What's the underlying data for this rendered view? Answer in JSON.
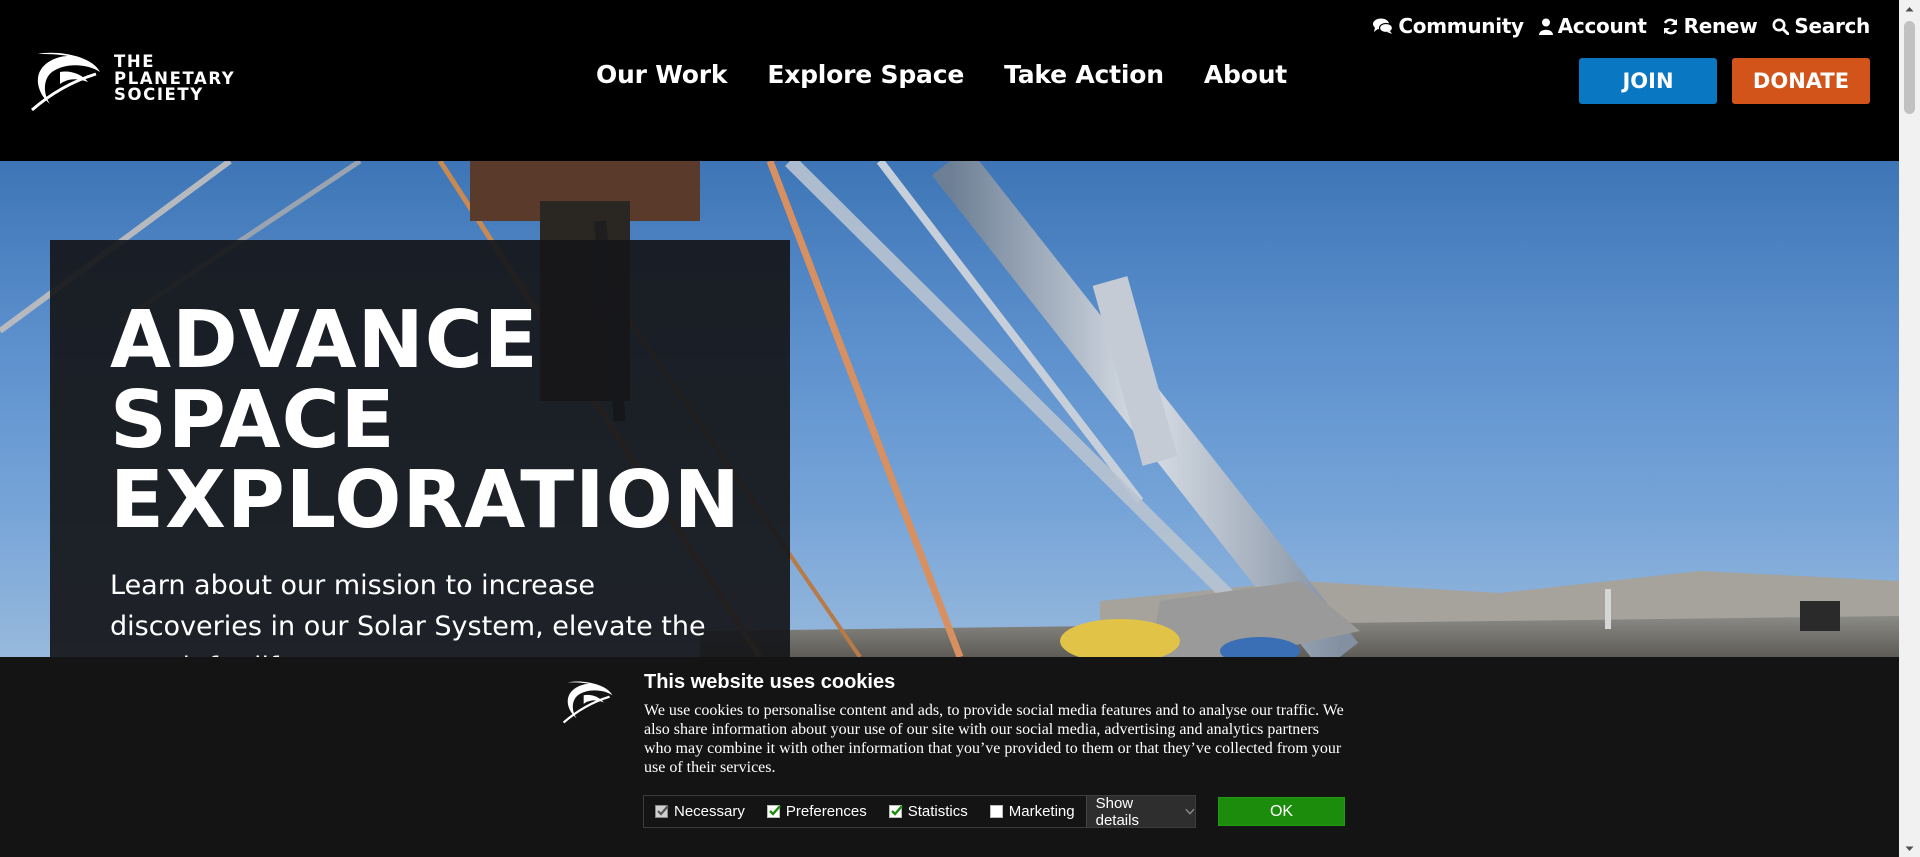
{
  "brand": {
    "name_lines": [
      "THE",
      "PLANETARY",
      "SOCIETY"
    ],
    "logo_icon": "planetary-society-swoosh"
  },
  "utility_nav": [
    {
      "label": "Community",
      "icon": "comments-icon"
    },
    {
      "label": "Account",
      "icon": "user-icon"
    },
    {
      "label": "Renew",
      "icon": "refresh-icon"
    },
    {
      "label": "Search",
      "icon": "search-icon"
    }
  ],
  "main_nav": [
    "Our Work",
    "Explore Space",
    "Take Action",
    "About"
  ],
  "buttons": {
    "join": "JOIN",
    "donate": "DONATE"
  },
  "hero": {
    "title": "ADVANCE\nSPACE\nEXPLORATION",
    "lead": "Learn about our mission to increase discoveries in our Solar System, elevate the search for life"
  },
  "cookie": {
    "title": "This website uses cookies",
    "text": "We use cookies to personalise content and ads, to provide social media features and to analyse our traffic. We also share information about your use of our site with our social media, advertising and analytics partners who may combine it with other information that you’ve provided to them or that they’ve collected from your use of their services.",
    "options": [
      {
        "label": "Necessary",
        "checked": true,
        "disabled": true
      },
      {
        "label": "Preferences",
        "checked": true,
        "disabled": false
      },
      {
        "label": "Statistics",
        "checked": true,
        "disabled": false
      },
      {
        "label": "Marketing",
        "checked": false,
        "disabled": false
      }
    ],
    "details_label": "Show details",
    "ok_label": "OK"
  },
  "colors": {
    "join": "#0a77c2",
    "donate": "#d3541a",
    "ok": "#1b8c0c",
    "checkbox_check": "#1b8c0c"
  }
}
